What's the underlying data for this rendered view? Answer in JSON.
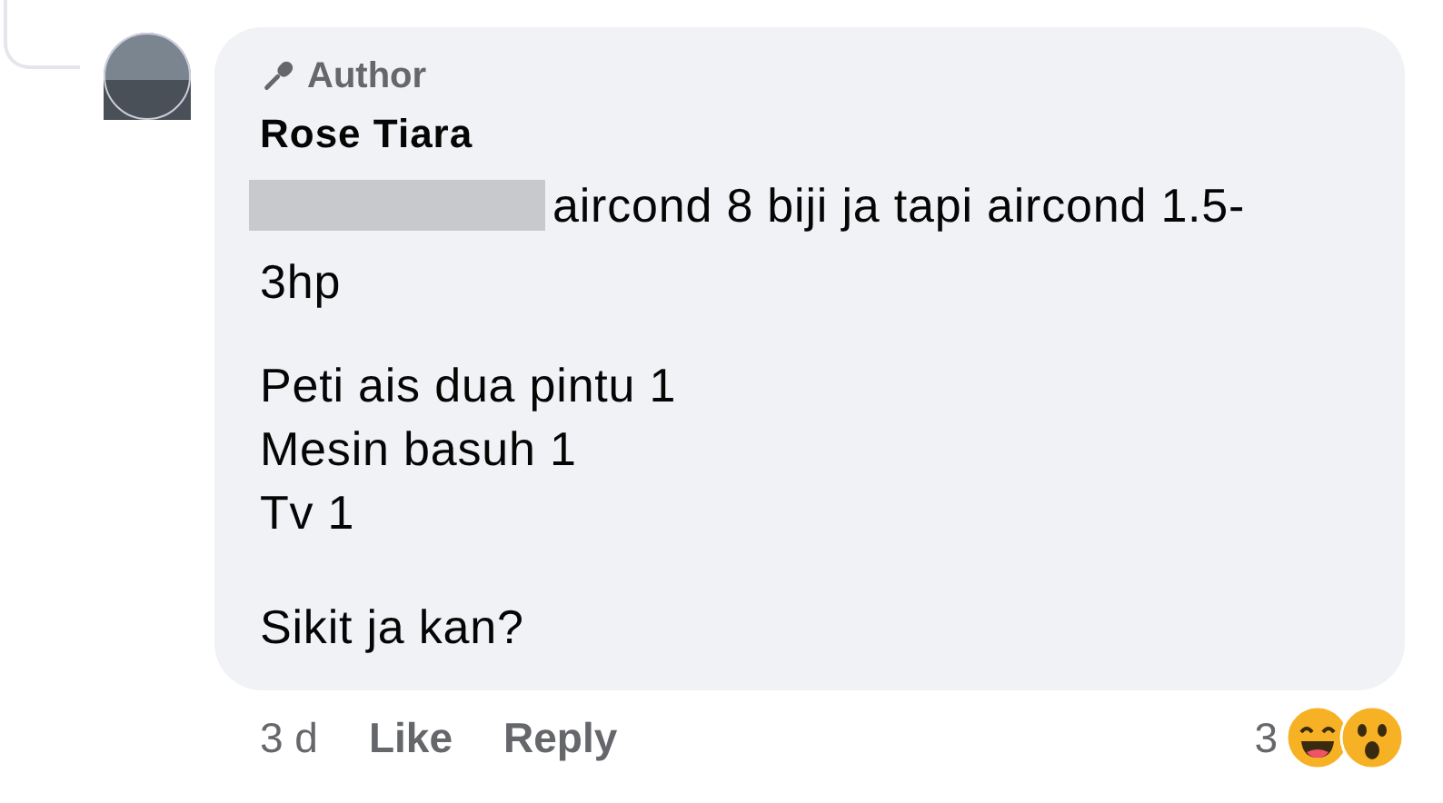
{
  "comment": {
    "badge": "Author",
    "author": "Rose Tiara",
    "body": [
      {
        "kind": "redacted-lead",
        "lines": [
          "aircond 8 biji ja tapi aircond 1.5-",
          "3hp"
        ]
      },
      {
        "kind": "lines",
        "lines": [
          "Peti ais dua pintu 1",
          "Mesin basuh 1",
          "Tv 1"
        ]
      },
      {
        "kind": "text",
        "text": "Sikit ja kan?"
      }
    ],
    "time": "3 d",
    "actions": [
      "Like",
      "Reply"
    ],
    "reaction_count": "3"
  }
}
